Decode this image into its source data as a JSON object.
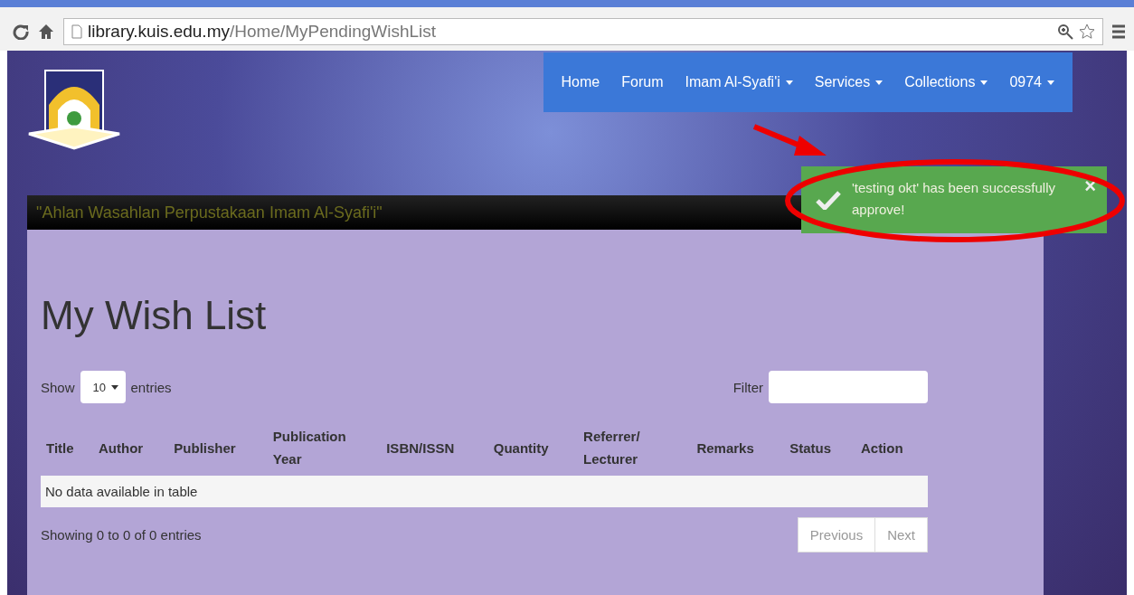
{
  "browser": {
    "url_host": "library.kuis.edu.my",
    "url_path": "/Home/MyPendingWishList"
  },
  "nav": {
    "items": [
      {
        "label": "Home",
        "dropdown": false
      },
      {
        "label": "Forum",
        "dropdown": false
      },
      {
        "label": "Imam Al-Syafi'i",
        "dropdown": true
      },
      {
        "label": "Services",
        "dropdown": true
      },
      {
        "label": "Collections",
        "dropdown": true
      },
      {
        "label": "0974",
        "dropdown": true
      }
    ]
  },
  "toast": {
    "message": "'testing okt' has been successfully approve!",
    "close": "×"
  },
  "banner": {
    "text": "\"Ahlan Wasahlan Perpustakaan Imam Al-Syafi'i\""
  },
  "page": {
    "title": "My Wish List"
  },
  "table": {
    "length_label_before": "Show",
    "length_value": "10",
    "length_label_after": "entries",
    "filter_label": "Filter",
    "columns": [
      "Title",
      "Author",
      "Publisher",
      "Publication Year",
      "ISBN/ISSN",
      "Quantity",
      "Referrer/ Lecturer",
      "Remarks",
      "Status",
      "Action"
    ],
    "empty_message": "No data available in table",
    "info": "Showing 0 to 0 of 0 entries",
    "pagination": [
      {
        "label": "Previous",
        "disabled": true
      },
      {
        "label": "Next",
        "disabled": true
      }
    ]
  }
}
